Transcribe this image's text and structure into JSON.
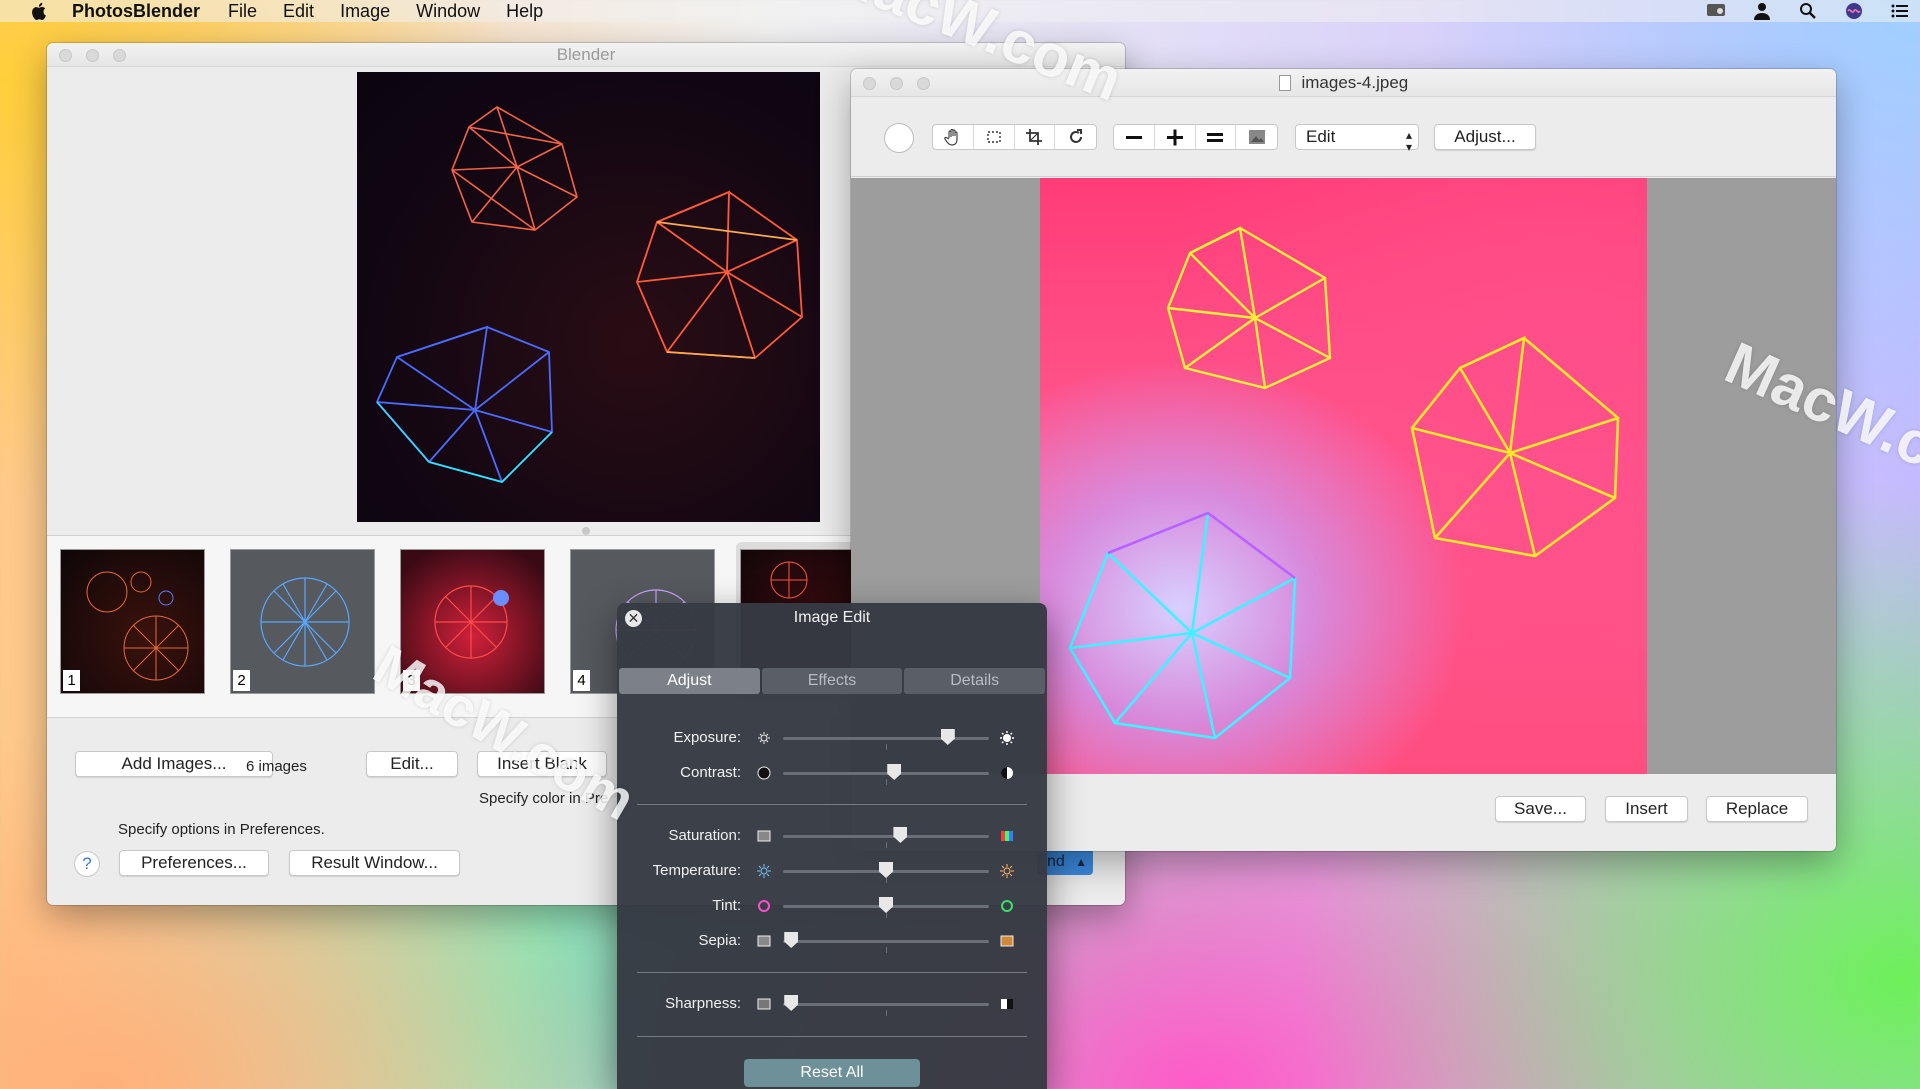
{
  "menubar": {
    "app_name": "PhotosBlender",
    "menus": [
      "File",
      "Edit",
      "Image",
      "Window",
      "Help"
    ],
    "right_icons": [
      "display-icon",
      "user-icon",
      "search-icon",
      "siri-icon",
      "list-icon"
    ]
  },
  "blender": {
    "title": "Blender",
    "thumbnails": [
      {
        "num": "1"
      },
      {
        "num": "2"
      },
      {
        "num": "3"
      },
      {
        "num": "4"
      }
    ],
    "add_images_label": "Add Images...",
    "count_label": "6 images",
    "edit_label": "Edit...",
    "insert_blank_label": "Insert Blank",
    "specify_color_label": "Specify color in Pre",
    "specify_options_label": "Specify options in Preferences.",
    "help_label": "?",
    "preferences_label": "Preferences...",
    "result_window_label": "Result Window...",
    "blend_label": "nd"
  },
  "image_window": {
    "title": "images-4.jpeg",
    "toolbar_icons": [
      "hand-icon",
      "select-icon",
      "crop-icon",
      "rotate-icon",
      "zoom-out-icon",
      "zoom-in-icon",
      "actual-size-icon",
      "fit-icon"
    ],
    "mode_select": "Edit",
    "adjust_label": "Adjust...",
    "save_label": "Save...",
    "insert_label": "Insert",
    "replace_label": "Replace"
  },
  "image_edit": {
    "title": "Image Edit",
    "tabs": [
      "Adjust",
      "Effects",
      "Details"
    ],
    "active_tab": "Adjust",
    "sliders": [
      {
        "label": "Exposure:",
        "value": 0.8
      },
      {
        "label": "Contrast:",
        "value": 0.54
      },
      {
        "label": "Saturation:",
        "value": 0.57
      },
      {
        "label": "Temperature:",
        "value": 0.5
      },
      {
        "label": "Tint:",
        "value": 0.5
      },
      {
        "label": "Sepia:",
        "value": 0.04
      },
      {
        "label": "Sharpness:",
        "value": 0.04
      }
    ],
    "reset_label": "Reset All"
  },
  "watermarks": [
    "MacW.com",
    "MacW.c",
    "MacW.com"
  ]
}
